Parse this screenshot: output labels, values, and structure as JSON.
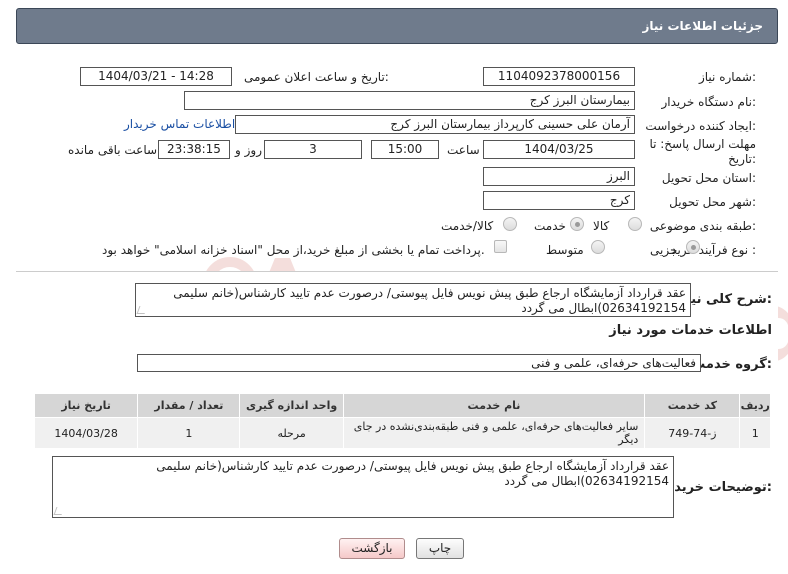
{
  "header": {
    "title": "جزئیات اطلاعات نیاز"
  },
  "form": {
    "need_number": {
      "label": "شماره نیاز:",
      "value": "1104092378000156"
    },
    "announce": {
      "label": "تاریخ و ساعت اعلان عمومی:",
      "value": "1404/03/21 - 14:28"
    },
    "buyer_org": {
      "label": "نام دستگاه خریدار:",
      "value": "بیمارستان البرز کرج"
    },
    "requester": {
      "label": "ایجاد کننده درخواست:",
      "value": "آرمان علی حسینی کارپرداز بیمارستان البرز کرج"
    },
    "contact_link": "اطلاعات تماس خریدار",
    "deadline": {
      "label_line1": "مهلت ارسال پاسخ: تا",
      "label_line2": "تاریخ:",
      "date": "1404/03/25",
      "time_label": "ساعت",
      "time": "15:00",
      "days": "3",
      "days_label": "روز و",
      "remaining": "23:38:15",
      "remaining_label": "ساعت باقی مانده"
    },
    "province": {
      "label": "استان محل تحویل:",
      "value": "البرز"
    },
    "city": {
      "label": "شهر محل تحویل:",
      "value": "کرج"
    },
    "category": {
      "label": "طبقه بندی موضوعی:",
      "options": [
        "کالا",
        "خدمت",
        "کالا/خدمت"
      ],
      "selected": "خدمت"
    },
    "purchase_type": {
      "label": "نوع فرآیند خرید :",
      "options": [
        "جزیی",
        "متوسط"
      ],
      "selected": "جزیی",
      "treasury_note": "پرداخت تمام یا بخشی از مبلغ خرید،از محل \"اسناد خزانه اسلامی\" خواهد بود."
    }
  },
  "description": {
    "label": "شرح کلی نیاز:",
    "text": "عقد قرارداد آزمایشگاه ارجاع طبق پیش نویس فایل پیوستی/ درصورت عدم تایید کارشناس(خانم سلیمی 02634192154)ابطال می گردد"
  },
  "services": {
    "section_title": "اطلاعات خدمات مورد نیاز",
    "group_label": "گروه خدمت:",
    "group_value": "فعالیت‌های حرفه‌ای، علمی و فنی",
    "columns": [
      "ردیف",
      "کد خدمت",
      "نام خدمت",
      "واحد اندازه گیری",
      "تعداد / مقدار",
      "تاریخ نیاز"
    ],
    "rows": [
      {
        "row": "1",
        "code": "ز-74-749",
        "name": "سایر فعالیت‌های حرفه‌ای، علمی و فنی طبقه‌بندی‌نشده در جای دیگر",
        "unit": "مرحله",
        "qty": "1",
        "date": "1404/03/28"
      }
    ]
  },
  "buyer_notes": {
    "label": "توضیحات خریدار:",
    "text": "عقد قرارداد آزمایشگاه ارجاع طبق پیش نویس فایل پیوستی/ درصورت عدم تایید کارشناس(خانم سلیمی 02634192154)ابطال می گردد"
  },
  "buttons": {
    "print": "چاپ",
    "back": "بازگشت"
  },
  "watermark": {
    "text": "AriaTender.neT"
  },
  "colors": {
    "titlebar": "#6f7b8c",
    "link": "#1a4fa3",
    "watermark": "#c0392b"
  }
}
